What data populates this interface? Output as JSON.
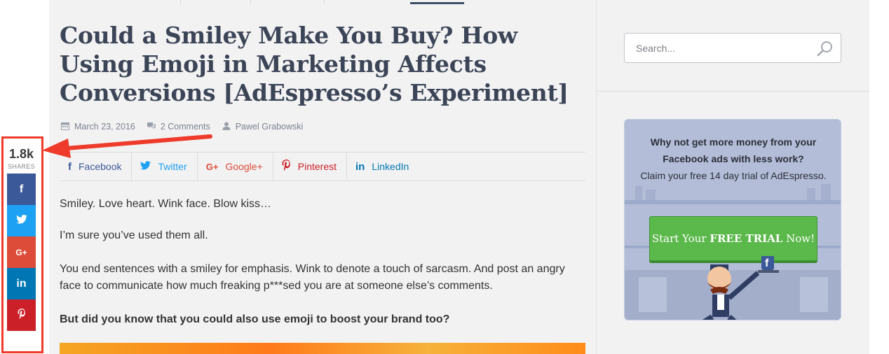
{
  "article": {
    "title": "Could a Smiley Make You Buy? How Using Emoji in Marketing Affects Conversions [AdEspresso’s Experiment]",
    "date": "March 23, 2016",
    "comments": "2 Comments",
    "author": "Pawel Grabowski",
    "paragraphs": [
      "Smiley. Love heart. Wink face. Blow kiss…",
      "I’m sure you’ve used them all.",
      "You end sentences with a smiley for emphasis. Wink to denote a touch of sarcasm. And post an angry face to communicate how much freaking p***sed you are at someone else’s comments.",
      "But did you know that you could also use emoji to boost your brand too?"
    ]
  },
  "share_bar": {
    "facebook": "Facebook",
    "twitter": "Twitter",
    "googleplus": "Google+",
    "pinterest": "Pinterest",
    "linkedin": "LinkedIn"
  },
  "floating_share": {
    "count": "1.8k",
    "label": "SHARES",
    "facebook_glyph": "f",
    "googleplus_glyph": "G+",
    "linkedin_glyph": "in"
  },
  "sidebar": {
    "search_placeholder": "Search...",
    "ad": {
      "headline": "Why not get more money from your Facebook ads with less work?",
      "subline": "Claim your free 14 day trial of AdEspresso.",
      "cta_prefix": "Start Your ",
      "cta_bold": "FREE TRIAL",
      "cta_suffix": " Now!",
      "mascot_glyph": "f"
    }
  },
  "icons": [
    "calendar-icon",
    "comments-icon",
    "user-icon",
    "facebook-icon",
    "twitter-icon",
    "googleplus-icon",
    "pinterest-icon",
    "linkedin-icon",
    "search-icon"
  ],
  "colors": {
    "facebook": "#3b5998",
    "twitter": "#1da1f2",
    "googleplus": "#dd4b39",
    "linkedin": "#0077b5",
    "pinterest": "#cb2027",
    "highlight": "#ee3b2b",
    "cta": "#5bb84a"
  }
}
